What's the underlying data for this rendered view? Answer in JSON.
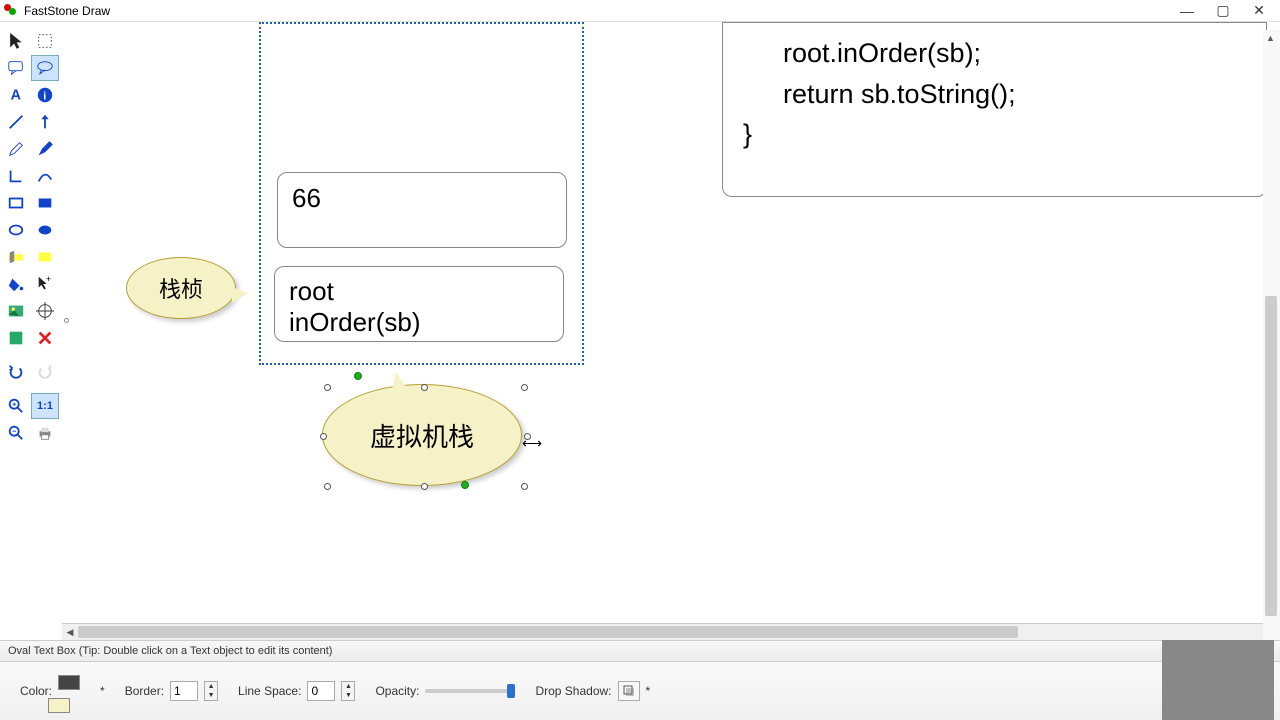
{
  "titlebar": {
    "title": "FastStone Draw"
  },
  "code": {
    "line1": "root.inOrder(sb);",
    "line2": "return sb.toString();",
    "line3": "}"
  },
  "card1_text": "66",
  "card2_line1": "root",
  "card2_line2": "inOrder(sb)",
  "bubble1_text": "栈桢",
  "bubble2_text": "虚拟机栈",
  "status_text": "Oval Text Box (Tip: Double click on a Text object to edit its content)",
  "propbar": {
    "color_label": "Color:",
    "color_star": "*",
    "border_label": "Border:",
    "border_val": "1",
    "linespace_label": "Line Space:",
    "linespace_val": "0",
    "opacity_label": "Opacity:",
    "shadow_label": "Drop Shadow:",
    "shadow_star": "*"
  }
}
